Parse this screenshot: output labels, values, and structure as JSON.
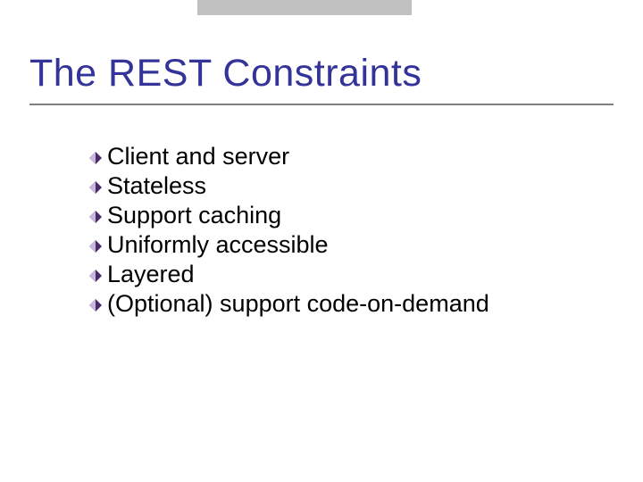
{
  "title": "The REST Constraints",
  "bullets": {
    "items": [
      {
        "label": "Client and server"
      },
      {
        "label": "Stateless"
      },
      {
        "label": "Support caching"
      },
      {
        "label": "Uniformly accessible"
      },
      {
        "label": "Layered"
      },
      {
        "label": "(Optional) support code-on-demand"
      }
    ]
  },
  "colors": {
    "title": "#333399",
    "bullet_dark": "#4b2a6b",
    "bullet_light": "#c9b6db",
    "topbar": "#c0c0c0",
    "underline": "#808080"
  }
}
